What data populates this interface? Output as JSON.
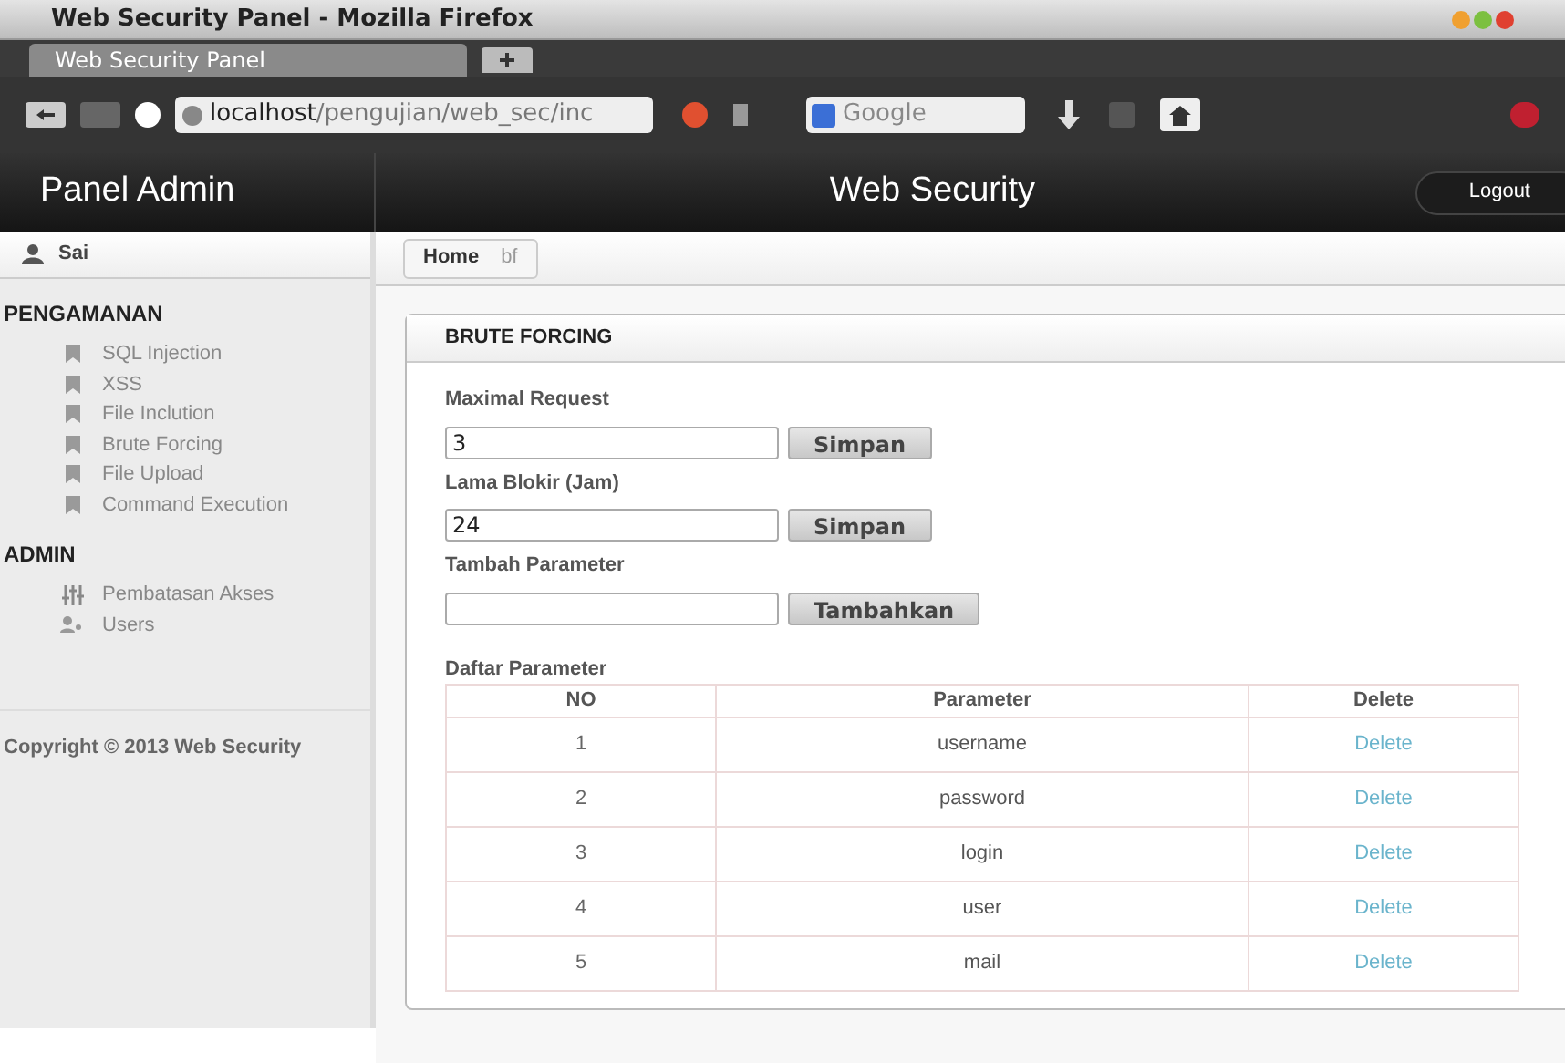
{
  "window": {
    "title": "Web Security Panel - Mozilla Firefox"
  },
  "browser": {
    "tab": "Web Security Panel",
    "url_host": "localhost",
    "url_path": "/pengujian/web_sec/inc",
    "search_placeholder": "Google"
  },
  "header": {
    "brand": "Panel Admin",
    "title": "Web Security",
    "logout": "Logout"
  },
  "user": "Sai",
  "sidebar": [
    {
      "heading": "PENGAMANAN",
      "items": [
        {
          "label": "SQL Injection",
          "kind": "bookmark"
        },
        {
          "label": "XSS",
          "kind": "bookmark"
        },
        {
          "label": "File Inclution",
          "kind": "bookmark"
        },
        {
          "label": "Brute Forcing",
          "kind": "bookmark"
        },
        {
          "label": "File Upload",
          "kind": "bookmark"
        },
        {
          "label": "Command Execution",
          "kind": "bookmark"
        }
      ]
    },
    {
      "heading": "ADMIN",
      "items": [
        {
          "label": "Pembatasan Akses",
          "kind": "sliders"
        },
        {
          "label": "Users",
          "kind": "users"
        }
      ]
    }
  ],
  "copyright": "Copyright © 2013 Web Security",
  "breadcrumb": [
    "Home",
    "bf"
  ],
  "panel": {
    "title": "BRUTE FORCING",
    "fields": [
      {
        "label": "Maximal Request",
        "value": "3",
        "button": "Simpan"
      },
      {
        "label": "Lama Blokir (Jam)",
        "value": "24",
        "button": "Simpan"
      },
      {
        "label": "Tambah Parameter",
        "button": "Tambahkan"
      }
    ],
    "table_title": "Daftar Parameter",
    "columns": [
      "NO",
      "Parameter",
      "Delete"
    ],
    "rows": [
      {
        "no": "1",
        "parameter": "username",
        "action": "Delete"
      },
      {
        "no": "2",
        "parameter": "password",
        "action": "Delete"
      },
      {
        "no": "3",
        "parameter": "login",
        "action": "Delete"
      },
      {
        "no": "4",
        "parameter": "user",
        "action": "Delete"
      },
      {
        "no": "5",
        "parameter": "mail",
        "action": "Delete"
      }
    ]
  }
}
